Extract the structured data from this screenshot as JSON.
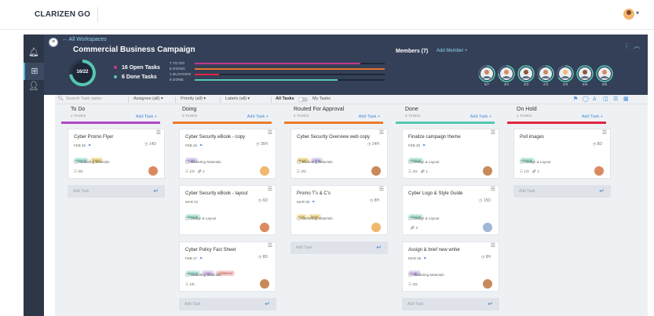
{
  "app": {
    "brand": "CLARIZEN GO"
  },
  "header": {
    "back_link": "← All Workspaces",
    "title": "Commercial Business Campaign",
    "progress": {
      "label": "16/22",
      "done": 16,
      "total": 22
    },
    "open_tasks": "16 Open Tasks",
    "done_tasks": "6 Done Tasks",
    "statuses": [
      {
        "label": "7 TO DO",
        "fraction": 0.87,
        "color": "#c23a8c"
      },
      {
        "label": "8 DOING",
        "fraction": 1.0,
        "color": "#e8742a"
      },
      {
        "label": "1 BLOCKED",
        "fraction": 0.13,
        "color": "#e0263f"
      },
      {
        "label": "6 DONE",
        "fraction": 0.75,
        "color": "#55c7b0"
      }
    ],
    "members_label": "Members (7)",
    "add_member": "Add Member +",
    "members": [
      {
        "count": "5/7",
        "progress": 0.7
      },
      {
        "count": "3/4",
        "progress": 0.75
      },
      {
        "count": "3/3",
        "progress": 1.0
      },
      {
        "count": "2/3",
        "progress": 0.66
      },
      {
        "count": "2/3",
        "progress": 0.66
      },
      {
        "count": "6/6",
        "progress": 1.0
      },
      {
        "count": "6/6",
        "progress": 1.0
      }
    ]
  },
  "toolbar": {
    "search_placeholder": "Search Task name",
    "assignee": "Assignee (all)",
    "priority": "Priority (all)",
    "labels": "Labels (all)",
    "all_tasks": "All Tasks",
    "my_tasks": "My Tasks"
  },
  "columns": [
    {
      "title": "To Do",
      "count": "1 TASKS",
      "add": "Add Task +",
      "color": "#b147c8",
      "cards": [
        {
          "title": "Cyber Promo Flyer",
          "date": "FEB 25",
          "flag": true,
          "hours": "14D",
          "tags": [
            "design",
            "legal"
          ],
          "project": "Marketing Materials",
          "meta": "0/2",
          "attach": "",
          "avatar": "#d98b5f"
        }
      ],
      "add_task": "Add Task"
    },
    {
      "title": "Doing",
      "count": "3 TASKS",
      "add": "Add Task +",
      "color": "#ee7a2b",
      "cards": [
        {
          "title": "Cyber Security eBook - copy",
          "date": "FEB 26",
          "flag": true,
          "hours": "35H",
          "tags": [
            "copy"
          ],
          "project": "Marketing Materials",
          "meta": "1/3",
          "attach": "1",
          "avatar": "#f2b66d"
        },
        {
          "title": "Cyber Security eBook - layout",
          "date": "MAR 01",
          "flag": false,
          "hours": "6D",
          "tags": [
            "design"
          ],
          "project": "Design & Layout",
          "meta": "",
          "attach": "",
          "avatar": "#d98b5f"
        },
        {
          "title": "Cyber Policy Fact Sheet",
          "date": "FEB 17",
          "flag": true,
          "hours": "8D",
          "tags": [
            "design",
            "copy",
            "collateral"
          ],
          "project": "Marketing Materials",
          "meta": "1/6",
          "attach": "",
          "avatar": "#c9895b"
        }
      ],
      "add_task": "Add Task"
    },
    {
      "title": "Routed For Approval",
      "count": "2 TASKS",
      "add": "Add Task +",
      "color": "#ee7a2b",
      "cards": [
        {
          "title": "Cyber Security Overview web copy",
          "date": "",
          "flag": false,
          "hours": "24H",
          "tags": [
            "legal",
            "copy"
          ],
          "project": "Marketing Materials",
          "meta": "2/3",
          "attach": "",
          "avatar": "#c9895b"
        },
        {
          "title": "Promo T's & C's",
          "date": "MAR 05",
          "flag": true,
          "hours": "8H",
          "tags": [
            "cps",
            "legal"
          ],
          "project": "Marketing Materials",
          "meta": "",
          "attach": "",
          "avatar": "#f2b66d"
        }
      ],
      "add_task": "Add Task"
    },
    {
      "title": "Done",
      "count": "3 TASKS",
      "add": "Add Task +",
      "color": "#55c7b0",
      "cards": [
        {
          "title": "Finalize campaign theme",
          "date": "FEB 25",
          "flag": true,
          "hours": "",
          "tags": [
            "design"
          ],
          "project": "Design & Layout",
          "meta": "2/2",
          "attach": "1",
          "avatar": "#c9895b"
        },
        {
          "title": "Cyber Logo & Style Guide",
          "date": "",
          "flag": false,
          "hours": "15D",
          "tags": [
            "design"
          ],
          "project": "Design & Layout",
          "meta": "",
          "attach": "2",
          "avatar": "#9fb8d8"
        },
        {
          "title": "Assign & brief new writer",
          "date": "MAR 05",
          "flag": true,
          "hours": "8H",
          "tags": [
            "copy"
          ],
          "project": "Marketing Materials",
          "meta": "3/3",
          "attach": "",
          "avatar": "#c9895b"
        }
      ],
      "add_task": "Add Task"
    },
    {
      "title": "On Hold",
      "count": "1 TASKS",
      "add": "Add Task +",
      "color": "#e0263f",
      "cards": [
        {
          "title": "Pull images",
          "date": "",
          "flag": false,
          "hours": "8D",
          "tags": [
            "design"
          ],
          "project": "Design & Layout",
          "meta": "1/3",
          "attach": "1",
          "avatar": "#d98b5f"
        }
      ],
      "add_task": "Add Task"
    }
  ]
}
